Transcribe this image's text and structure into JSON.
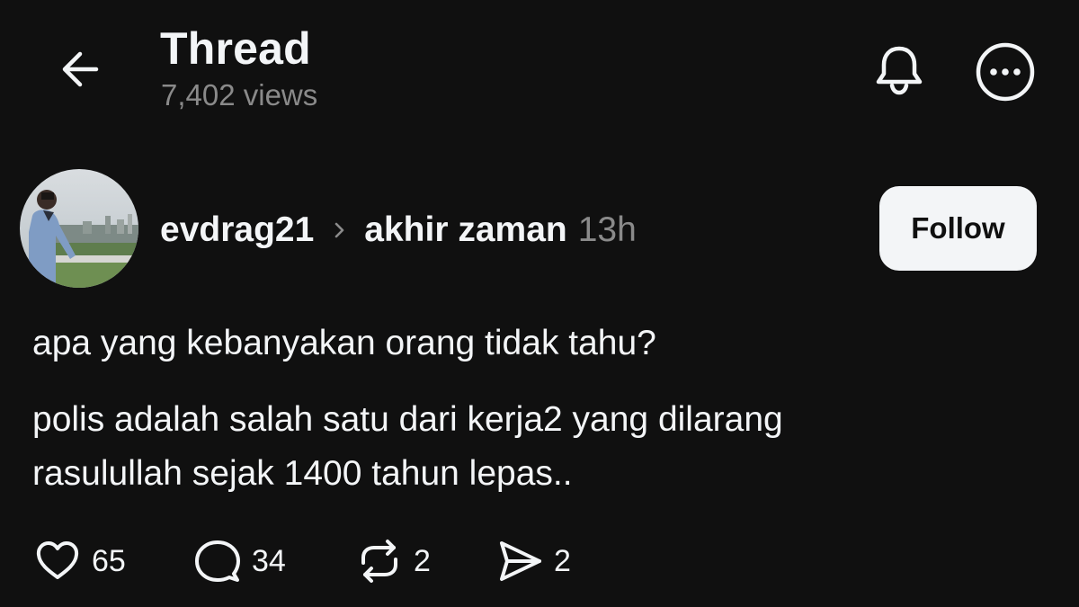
{
  "header": {
    "title": "Thread",
    "views": "7,402 views",
    "back_icon": "arrow-left-icon",
    "bell_icon": "bell-icon",
    "more_icon": "more-horizontal-icon"
  },
  "post": {
    "username": "evdrag21",
    "community": "akhir zaman",
    "time": "13h",
    "follow_label": "Follow",
    "question": "apa yang kebanyakan orang tidak tahu?",
    "body": "polis adalah salah satu dari kerja2 yang dilarang rasulullah sejak 1400 tahun lepas.."
  },
  "actions": {
    "likes": "65",
    "replies": "34",
    "reposts": "2",
    "shares": "2"
  },
  "colors": {
    "background": "#101010",
    "text": "#f3f5f7",
    "muted": "#8a8a8a",
    "follow_bg": "#f3f5f7"
  }
}
